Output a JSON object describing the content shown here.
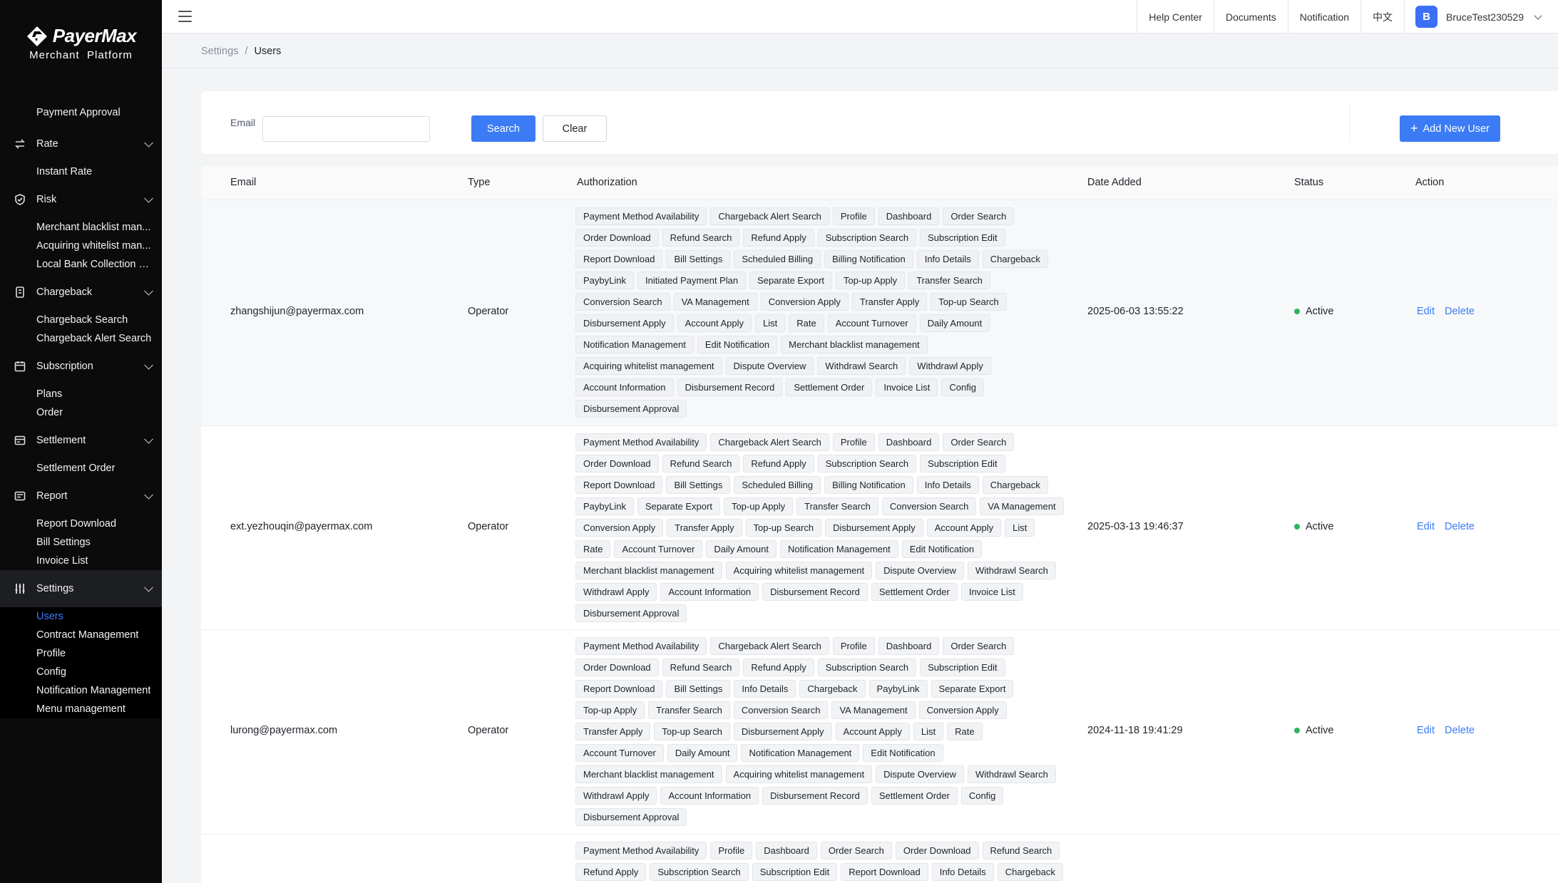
{
  "brand": {
    "name": "PayerMax",
    "subtitle": "Merchant  Platform"
  },
  "header": {
    "links": [
      "Help Center",
      "Documents",
      "Notification",
      "中文"
    ],
    "avatar_letter": "B",
    "username": "BruceTest230529"
  },
  "breadcrumb": {
    "parent": "Settings",
    "separator": "/",
    "current": "Users"
  },
  "sidebar": {
    "top_items": [
      "Payment Approval"
    ],
    "groups": [
      {
        "label": "Rate",
        "icon": "exchange-icon",
        "children": [
          "Instant Rate"
        ]
      },
      {
        "label": "Risk",
        "icon": "shield-icon",
        "children": [
          "Merchant blacklist man...",
          "Acquiring whitelist man...",
          "Local Bank Collection List"
        ]
      },
      {
        "label": "Chargeback",
        "icon": "chargeback-icon",
        "children": [
          "Chargeback Search",
          "Chargeback Alert Search"
        ]
      },
      {
        "label": "Subscription",
        "icon": "calendar-icon",
        "children": [
          "Plans",
          "Order"
        ]
      },
      {
        "label": "Settlement",
        "icon": "settlement-icon",
        "children": [
          "Settlement Order"
        ]
      },
      {
        "label": "Report",
        "icon": "report-icon",
        "children": [
          "Report Download",
          "Bill Settings",
          "Invoice List"
        ]
      },
      {
        "label": "Settings",
        "icon": "sliders-icon",
        "children": [
          "Users",
          "Contract Management",
          "Profile",
          "Config",
          "Notification Management",
          "Menu management"
        ]
      }
    ],
    "active_item": "Users"
  },
  "filter": {
    "email_label": "Email",
    "email_value": "",
    "email_placeholder": "",
    "search_label": "Search",
    "clear_label": "Clear",
    "add_user_label": "Add New User"
  },
  "table": {
    "columns": [
      "Email",
      "Type",
      "Authorization",
      "Date Added",
      "Status",
      "Action"
    ],
    "actions": {
      "edit": "Edit",
      "delete": "Delete"
    },
    "rows": [
      {
        "email": "zhangshijun@payermax.com",
        "type": "Operator",
        "date_added": "2025-06-03 13:55:22",
        "status": "Active",
        "authorization_lines": [
          [
            "Payment Method Availability",
            "Chargeback Alert Search",
            "Profile",
            "Dashboard",
            "Order Search"
          ],
          [
            "Order Download",
            "Refund Search",
            "Refund Apply",
            "Subscription Search",
            "Subscription Edit"
          ],
          [
            "Report Download",
            "Bill Settings",
            "Scheduled Billing",
            "Billing Notification",
            "Info Details",
            "Chargeback"
          ],
          [
            "PaybyLink",
            "Initiated Payment Plan",
            "Separate Export",
            "Top-up Apply",
            "Transfer Search"
          ],
          [
            "Conversion Search",
            "VA Management",
            "Conversion Apply",
            "Transfer Apply",
            "Top-up Search"
          ],
          [
            "Disbursement Apply",
            "Account Apply",
            "List",
            "Rate",
            "Account Turnover",
            "Daily Amount"
          ],
          [
            "Notification Management",
            "Edit Notification",
            "Merchant blacklist management"
          ],
          [
            "Acquiring whitelist management",
            "Dispute Overview",
            "Withdrawl Search",
            "Withdrawl Apply"
          ],
          [
            "Account Information",
            "Disbursement Record",
            "Settlement Order",
            "Invoice List",
            "Config"
          ],
          [
            "Disbursement Approval"
          ]
        ]
      },
      {
        "email": "ext.yezhouqin@payermax.com",
        "type": "Operator",
        "date_added": "2025-03-13 19:46:37",
        "status": "Active",
        "authorization_lines": [
          [
            "Payment Method Availability",
            "Chargeback Alert Search",
            "Profile",
            "Dashboard",
            "Order Search"
          ],
          [
            "Order Download",
            "Refund Search",
            "Refund Apply",
            "Subscription Search",
            "Subscription Edit"
          ],
          [
            "Report Download",
            "Bill Settings",
            "Scheduled Billing",
            "Billing Notification",
            "Info Details",
            "Chargeback"
          ],
          [
            "PaybyLink",
            "Separate Export",
            "Top-up Apply",
            "Transfer Search",
            "Conversion Search",
            "VA Management"
          ],
          [
            "Conversion Apply",
            "Transfer Apply",
            "Top-up Search",
            "Disbursement Apply",
            "Account Apply",
            "List"
          ],
          [
            "Rate",
            "Account Turnover",
            "Daily Amount",
            "Notification Management",
            "Edit Notification"
          ],
          [
            "Merchant blacklist management",
            "Acquiring whitelist management",
            "Dispute Overview",
            "Withdrawl Search"
          ],
          [
            "Withdrawl Apply",
            "Account Information",
            "Disbursement Record",
            "Settlement Order",
            "Invoice List"
          ],
          [
            "Disbursement Approval"
          ]
        ]
      },
      {
        "email": "lurong@payermax.com",
        "type": "Operator",
        "date_added": "2024-11-18 19:41:29",
        "status": "Active",
        "authorization_lines": [
          [
            "Payment Method Availability",
            "Chargeback Alert Search",
            "Profile",
            "Dashboard",
            "Order Search"
          ],
          [
            "Order Download",
            "Refund Search",
            "Refund Apply",
            "Subscription Search",
            "Subscription Edit"
          ],
          [
            "Report Download",
            "Bill Settings",
            "Info Details",
            "Chargeback",
            "PaybyLink",
            "Separate Export"
          ],
          [
            "Top-up Apply",
            "Transfer Search",
            "Conversion Search",
            "VA Management",
            "Conversion Apply"
          ],
          [
            "Transfer Apply",
            "Top-up Search",
            "Disbursement Apply",
            "Account Apply",
            "List",
            "Rate"
          ],
          [
            "Account Turnover",
            "Daily Amount",
            "Notification Management",
            "Edit Notification"
          ],
          [
            "Merchant blacklist management",
            "Acquiring whitelist management",
            "Dispute Overview",
            "Withdrawl Search"
          ],
          [
            "Withdrawl Apply",
            "Account Information",
            "Disbursement Record",
            "Settlement Order",
            "Config"
          ],
          [
            "Disbursement Approval"
          ]
        ]
      },
      {
        "email": "",
        "type": "",
        "date_added": "",
        "status": "",
        "authorization_lines": [
          [
            "Payment Method Availability",
            "Profile",
            "Dashboard",
            "Order Search",
            "Order Download",
            "Refund Search"
          ],
          [
            "Refund Apply",
            "Subscription Search",
            "Subscription Edit",
            "Report Download",
            "Info Details",
            "Chargeback"
          ]
        ]
      }
    ]
  },
  "colors": {
    "sidebar_bg": "#0b0b0c",
    "accent": "#3b7bf6",
    "active_status": "#2db55d"
  }
}
